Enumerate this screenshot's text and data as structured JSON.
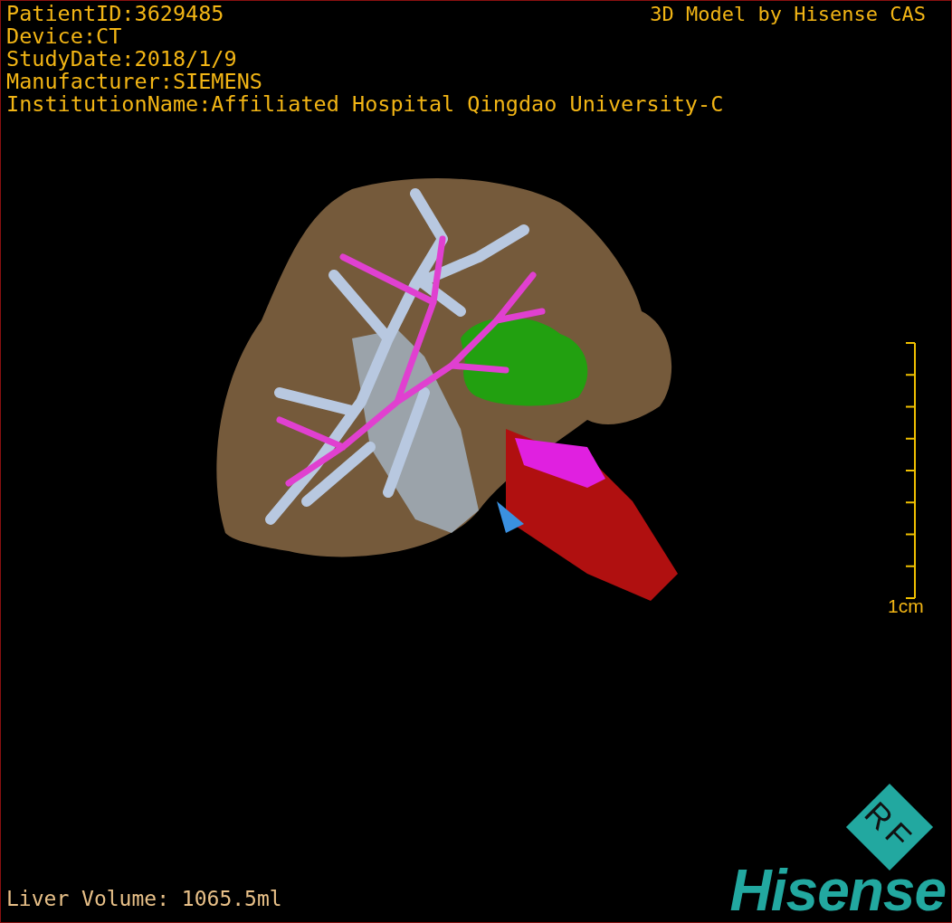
{
  "study_info": [
    "PatientID:3629485",
    "Device:CT",
    "StudyDate:2018/1/9",
    "Manufacturer:SIEMENS",
    "InstitutionName:Affiliated Hospital Qingdao University-C"
  ],
  "credit": "3D Model by Hisense CAS",
  "scale_bar": {
    "label": "1cm"
  },
  "liver_volume": "Liver Volume: 1065.5ml",
  "logo": {
    "badge": "RF",
    "wordmark": "Hisense"
  }
}
